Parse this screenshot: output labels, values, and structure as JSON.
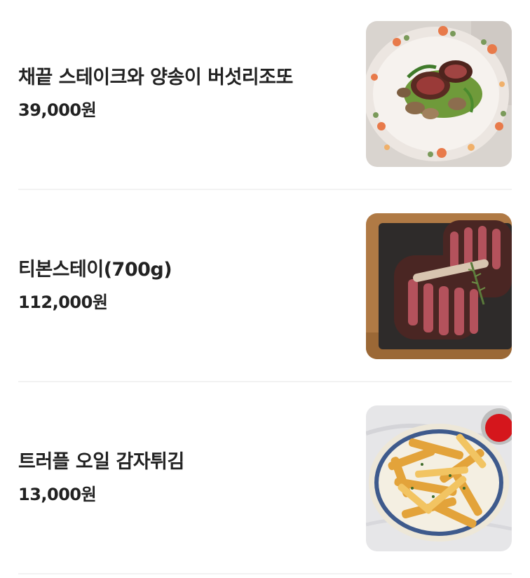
{
  "menu": {
    "items": [
      {
        "name": "채끝 스테이크와 양송이 버섯리조또",
        "price": "39,000원",
        "image": "steak-risotto-photo"
      },
      {
        "name": "티본스테이(700g)",
        "price": "112,000원",
        "image": "tbone-steak-photo"
      },
      {
        "name": "트러플 오일 감자튀김",
        "price": "13,000원",
        "image": "truffle-fries-photo"
      }
    ]
  }
}
